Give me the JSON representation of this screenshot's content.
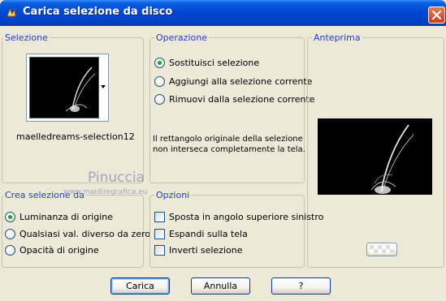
{
  "window": {
    "title": "Carica selezione da disco"
  },
  "selezione": {
    "label": "Selezione",
    "preset_name": "maelledreams-selection12"
  },
  "operazione": {
    "label": "Operazione",
    "options": [
      {
        "label": "Sostituisci selezione",
        "checked": true
      },
      {
        "label": "Aggiungi alla selezione corrente",
        "checked": false
      },
      {
        "label": "Rimuovi dalla selezione corrente",
        "checked": false
      }
    ],
    "message_line1": "Il rettangolo originale della selezione",
    "message_line2": "non interseca completamente la tela."
  },
  "anteprima": {
    "label": "Anteprima"
  },
  "crea": {
    "label": "Crea selezione da",
    "options": [
      {
        "label": "Luminanza di origine",
        "checked": true
      },
      {
        "label": "Qualsiasi val. diverso da zero",
        "checked": false
      },
      {
        "label": "Opacità di origine",
        "checked": false
      }
    ]
  },
  "opzioni": {
    "label": "Opzioni",
    "options": [
      {
        "label": "Sposta in angolo superiore sinistro",
        "checked": false
      },
      {
        "label": "Espandi sulla tela",
        "checked": false
      },
      {
        "label": "Inverti selezione",
        "checked": false
      }
    ]
  },
  "watermark": {
    "line1": "Pinuccia",
    "line2": "www.maidiregrafica.eu"
  },
  "buttons": {
    "carica": "Carica",
    "annulla": "Annulla",
    "help": "?"
  }
}
